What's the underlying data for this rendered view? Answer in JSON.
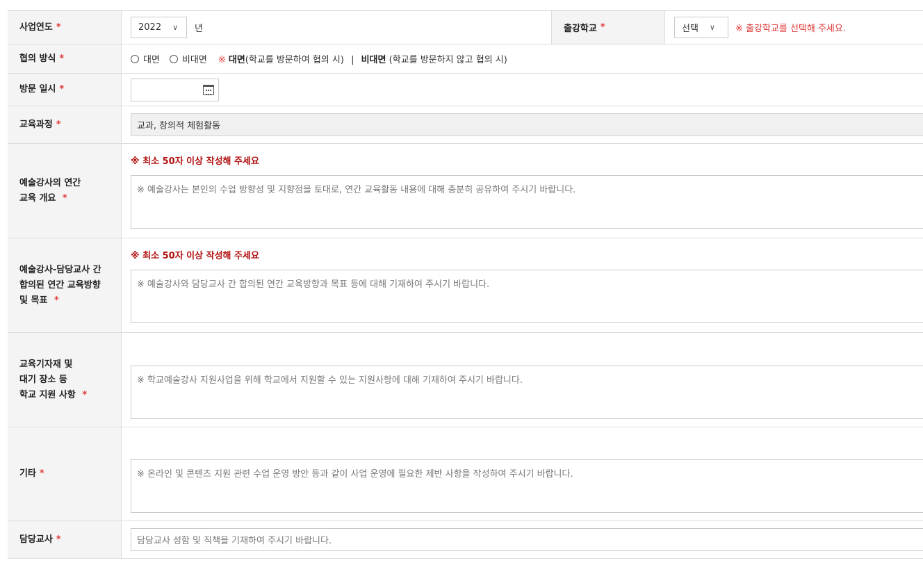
{
  "required_mark": "*",
  "business_year": {
    "label": "사업연도",
    "selected": "2022",
    "unit": "년"
  },
  "school": {
    "label": "출강학교",
    "selected": "선택",
    "note": "※ 출강학교를 선택해 주세요."
  },
  "method": {
    "label": "협의 방식",
    "options": [
      "대면",
      "비대면"
    ],
    "note_mark": "※",
    "note_face": "대면",
    "note_face_desc": "(학교를 방문하여 협의 시)",
    "note_sep": "|",
    "note_nonface": "비대면",
    "note_nonface_desc": "(학교를 방문하지 않고 협의 시)"
  },
  "visit_date": {
    "label": "방문 일시"
  },
  "curriculum": {
    "label": "교육과정",
    "value": "교과, 창의적 체험활동"
  },
  "overview": {
    "label_line1": "예술강사의 연간",
    "label_line2": "교육 개요",
    "min_note": "※ 최소 50자 이상 작성해 주세요",
    "placeholder": "※ 예술강사는 본인의 수업 방향성 및 지향점을 토대로, 연간 교육활동 내용에 대해 충분히 공유하여 주시기 바랍니다."
  },
  "direction": {
    "label_line1": "예술강사-담당교사 간",
    "label_line2": "합의된 연간 교육방향",
    "label_line3": "및 목표",
    "min_note": "※ 최소 50자 이상 작성해 주세요",
    "placeholder": "※ 예술강사와 담당교사 간 합의된 연간 교육방향과 목표 등에 대해 기재하여 주시기 바랍니다."
  },
  "support": {
    "label_line1": "교육기자재 및",
    "label_line2": "대기 장소 등",
    "label_line3": "학교 지원 사항",
    "placeholder": "※ 학교예술강사 지원사업을 위해 학교에서 지원할 수 있는 지원사항에 대해 기재하여 주시기 바랍니다."
  },
  "etc": {
    "label": "기타",
    "placeholder": "※ 온라인 및 콘텐츠 지원 관련 수업 운영 방안 등과 같이 사업 운영에 필요한 제반 사항을 작성하여 주시기 바랍니다."
  },
  "teacher": {
    "label": "담당교사",
    "placeholder": "담당교사 성함 및 직책을 기재하여 주시기 바랍니다."
  }
}
